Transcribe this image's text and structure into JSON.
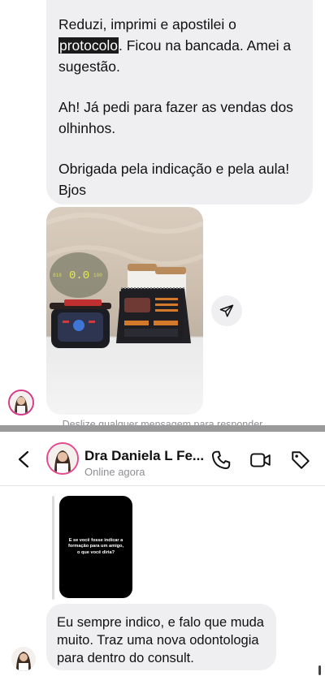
{
  "top_message": {
    "para1_before": "Reduzi, imprimi e apostilei o ",
    "para1_highlight": "protocolo",
    "para1_after": ". Ficou na bancada. Amei a sugestão.",
    "para2": "Ah! Já pedi para fazer as vendas dos olhinhos.",
    "para3": "Obrigada pela indicação e pela aula! Bjos"
  },
  "photo": {
    "device_readout": "0.0",
    "device_left_value": "818",
    "device_right_value": "100"
  },
  "swipe_hint": "Deslize qualquer mensagem para responder",
  "header": {
    "name": "Dra Daniela L Fe...",
    "status": "Online agora"
  },
  "story_reply": {
    "story_text": "E se você fosse indicar a formação para um amigo, o que você diria?"
  },
  "bottom_message": {
    "text": "Eu sempre indico, e falo que muda muito. Traz uma nova odontologia para dentro do consult."
  },
  "colors": {
    "bubble_bg": "#efeff2",
    "story_ring": "#e44a8e",
    "muted_text": "#8e8e93"
  },
  "icons": [
    "back-chevron-icon",
    "phone-icon",
    "video-camera-icon",
    "tag-icon",
    "share-paper-plane-icon"
  ]
}
